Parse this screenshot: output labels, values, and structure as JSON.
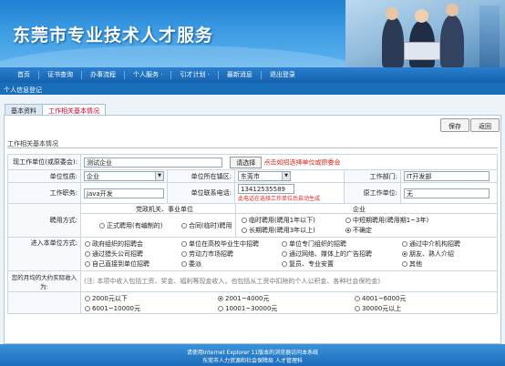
{
  "header": {
    "title": "东莞市专业技术人才服务"
  },
  "nav": {
    "items": [
      "首页",
      "证书查询",
      "办事流程",
      "个人服务 ·",
      "引才计划 ·",
      "最新消息",
      "退出登录"
    ]
  },
  "subbar": {
    "text": "个人信息登记"
  },
  "tabs": [
    {
      "label": "基本资料"
    },
    {
      "label": "工作相关基本情况"
    }
  ],
  "toolbar": {
    "save": "保存",
    "back": "返回"
  },
  "section": {
    "title": "工作相关基本情况"
  },
  "form": {
    "employer_label": "现工作单位(或原委会):",
    "employer_value": "测试企业",
    "choose_button": "请选择",
    "choose_hint": "点击如招选择单位或原委会",
    "unit_nature_label": "单位性质:",
    "unit_nature_value": "企业",
    "unit_area_label": "单位所在镇区:",
    "unit_area_value": "东莞市",
    "department_label": "工作部门:",
    "department_value": "IT开发部",
    "position_label": "工作职务:",
    "position_value": "java开发",
    "phone_label": "单位联系电话:",
    "phone_value": "13412535589",
    "phone_hint": "此电话在选择工作单位后自动生成",
    "orig_unit_label": "原工作单位:",
    "orig_unit_value": "无",
    "hire_label": "聘用方式:",
    "hire_group1": "党政机关、事业单位",
    "hire_group2": "企业",
    "hire_options": [
      "正式聘用(有编制的)",
      "合同(临时)聘用",
      "临时聘用(聘用1年以下)",
      "中短期聘用(聘用期1~3年)",
      "长期聘用(聘用3年以上)",
      "不确定"
    ],
    "entry_label": "进入本单位方式:",
    "entry_options": [
      "政府组织的招聘会",
      "单位在高校毕业生中招聘",
      "单位专门组织的招聘",
      "通过中介机构招聘",
      "通过猎头公司招聘",
      "劳动力市场招聘",
      "通过网络、媒体上的广告招聘",
      "朋友、熟人介绍",
      "自己直接到单位招聘",
      "委派",
      "复员、专业安置",
      "其他"
    ],
    "income_label": "您的月均的大约实际收入为:",
    "income_note": "(注: 本项中收入包括工资、奖金、福利等现金收入，也包括从工资中扣除的个人公积金、各种社会保险金)",
    "income_options": [
      "2000元以下",
      "2001~4000元",
      "4001~6000元",
      "6001~10000元",
      "10001~30000元",
      "30000元以上"
    ]
  },
  "footer": {
    "line1": "请使用Internet Explorer 11版本的浏览器访问本系统",
    "line2": "东莞市人力资源和社会保障局 人才管理科"
  }
}
